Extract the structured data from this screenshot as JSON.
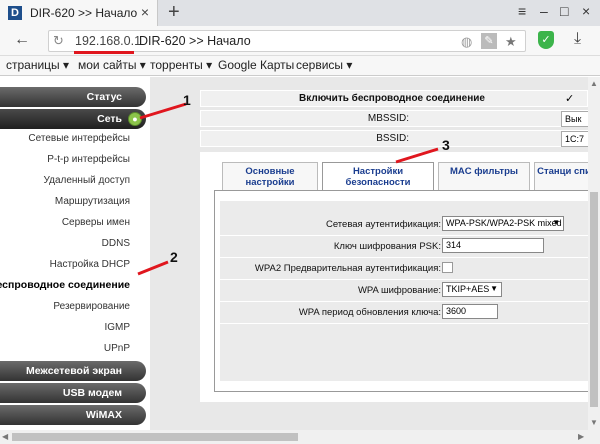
{
  "browser": {
    "tab_title": "DIR-620 >> Начало",
    "tab_close": "×",
    "new_tab": "+",
    "favicon_letter": "D",
    "window_controls": [
      "≡",
      "–",
      "□",
      "×"
    ]
  },
  "address": {
    "host": "192.168.0.1",
    "title": "DIR-620 >> Начало",
    "host_underline_color": "#e0161e"
  },
  "bookmarks": [
    "страницы ▾",
    "мои сайты ▾",
    "торренты ▾",
    "Google Карты",
    "сервисы ▾"
  ],
  "sidebar": {
    "status": "Статус",
    "network": "Сеть",
    "network_items": [
      "Сетевые интерфейсы",
      "P-t-p интерфейсы",
      "Удаленный доступ",
      "Маршрутизация",
      "Серверы имен",
      "DDNS",
      "Настройка DHCP",
      "Беспроводное соединение",
      "Резервирование",
      "IGMP",
      "UPnP"
    ],
    "active_item": "Беспроводное соединение",
    "firewall": "Межсетевой экран",
    "usb": "USB модем",
    "wimax": "WiMAX"
  },
  "top_settings": {
    "enable_wireless_label": "Включить беспроводное соединение",
    "mbssid_label": "MBSSID:",
    "mbssid_value": "Вык",
    "bssid_label": "BSSID:",
    "bssid_value": "1C:7"
  },
  "tabs": [
    "Основные настройки",
    "Настройки безопасности",
    "MAC фильтры",
    "Станци спи"
  ],
  "security_form": {
    "auth_label": "Сетевая аутентификация:",
    "auth_value": "WPA-PSK/WPA2-PSK mixed",
    "psk_label": "Ключ шифрования PSK:",
    "psk_value": "314",
    "wpa2_preauth_label": "WPA2 Предварительная аутентификация:",
    "wpa_cipher_label": "WPA шифрование:",
    "wpa_cipher_value": "TKIP+AES",
    "wpa_rekey_label": "WPA период обновления ключа:",
    "wpa_rekey_value": "3600"
  },
  "annotations": [
    "1",
    "2",
    "3"
  ],
  "colors": {
    "annotation_arrow": "#e0161e",
    "tab_text": "#1a3d8f",
    "menu_pill": "#333333",
    "active_dot": "#8bc34a"
  }
}
